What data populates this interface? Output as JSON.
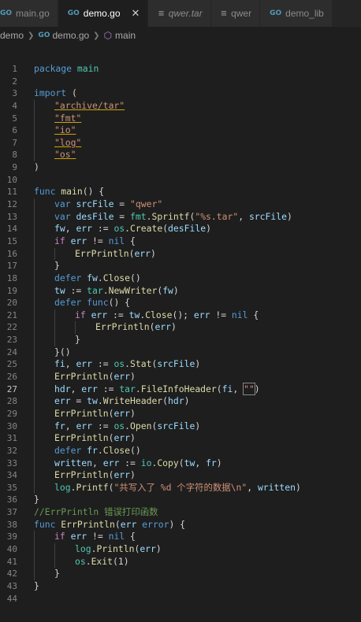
{
  "tabs": [
    {
      "label": "main.go",
      "icon": "go-file-icon",
      "active": false,
      "italic": false
    },
    {
      "label": "demo.go",
      "icon": "go-file-icon",
      "active": true,
      "italic": false
    },
    {
      "label": "qwer.tar",
      "icon": "file-icon",
      "active": false,
      "italic": true
    },
    {
      "label": "qwer",
      "icon": "file-icon",
      "active": false,
      "italic": false
    },
    {
      "label": "demo_lib",
      "icon": "go-file-icon",
      "active": false,
      "italic": false
    }
  ],
  "tab_close_glyph": "✕",
  "breadcrumb": {
    "folder": "demo",
    "file": "demo.go",
    "symbol": "main"
  },
  "editor": {
    "current_line": 27,
    "lines": [
      "",
      "package main",
      "",
      "import (",
      "\t\"archive/tar\"",
      "\t\"fmt\"",
      "\t\"io\"",
      "\t\"log\"",
      "\t\"os\"",
      ")",
      "",
      "func main() {",
      "\tvar srcFile = \"qwer\"",
      "\tvar desFile = fmt.Sprintf(\"%s.tar\", srcFile)",
      "\tfw, err := os.Create(desFile)",
      "\tif err != nil {",
      "\t\tErrPrintln(err)",
      "\t}",
      "\tdefer fw.Close()",
      "\ttw := tar.NewWriter(fw)",
      "\tdefer func() {",
      "\t\tif err := tw.Close(); err != nil {",
      "\t\t\tErrPrintln(err)",
      "\t\t}",
      "\t}()",
      "\tfi, err := os.Stat(srcFile)",
      "\tErrPrintln(err)",
      "\thdr, err := tar.FileInfoHeader(fi, \"\")",
      "\terr = tw.WriteHeader(hdr)",
      "\tErrPrintln(err)",
      "\tfr, err := os.Open(srcFile)",
      "\tErrPrintln(err)",
      "\tdefer fr.Close()",
      "\twritten, err := io.Copy(tw, fr)",
      "\tErrPrintln(err)",
      "\tlog.Printf(\"共写入了 %d 个字符的数据\\n\", written)",
      "}",
      "//ErrPrintln 错误打印函数",
      "func ErrPrintln(err error) {",
      "\tif err != nil {",
      "\t\tlog.Println(err)",
      "\t\tos.Exit(1)",
      "\t}",
      "}",
      ""
    ]
  },
  "colors": {
    "background": "#1e1e1e",
    "keyword": "#569cd6",
    "control": "#c586c0",
    "function": "#dcdcaa",
    "string": "#ce9178",
    "variable": "#9cdcfe",
    "type": "#4ec9b0",
    "comment": "#6a9955"
  }
}
